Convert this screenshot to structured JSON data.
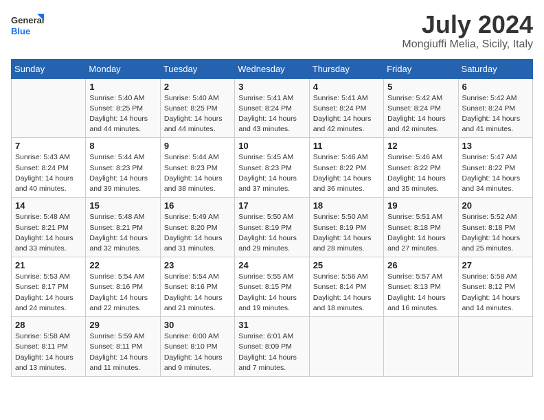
{
  "header": {
    "logo_line1": "General",
    "logo_line2": "Blue",
    "month": "July 2024",
    "location": "Mongiuffi Melia, Sicily, Italy"
  },
  "days_of_week": [
    "Sunday",
    "Monday",
    "Tuesday",
    "Wednesday",
    "Thursday",
    "Friday",
    "Saturday"
  ],
  "weeks": [
    [
      {
        "day": "",
        "sunrise": "",
        "sunset": "",
        "daylight": ""
      },
      {
        "day": "1",
        "sunrise": "Sunrise: 5:40 AM",
        "sunset": "Sunset: 8:25 PM",
        "daylight": "Daylight: 14 hours and 44 minutes."
      },
      {
        "day": "2",
        "sunrise": "Sunrise: 5:40 AM",
        "sunset": "Sunset: 8:25 PM",
        "daylight": "Daylight: 14 hours and 44 minutes."
      },
      {
        "day": "3",
        "sunrise": "Sunrise: 5:41 AM",
        "sunset": "Sunset: 8:24 PM",
        "daylight": "Daylight: 14 hours and 43 minutes."
      },
      {
        "day": "4",
        "sunrise": "Sunrise: 5:41 AM",
        "sunset": "Sunset: 8:24 PM",
        "daylight": "Daylight: 14 hours and 42 minutes."
      },
      {
        "day": "5",
        "sunrise": "Sunrise: 5:42 AM",
        "sunset": "Sunset: 8:24 PM",
        "daylight": "Daylight: 14 hours and 42 minutes."
      },
      {
        "day": "6",
        "sunrise": "Sunrise: 5:42 AM",
        "sunset": "Sunset: 8:24 PM",
        "daylight": "Daylight: 14 hours and 41 minutes."
      }
    ],
    [
      {
        "day": "7",
        "sunrise": "Sunrise: 5:43 AM",
        "sunset": "Sunset: 8:24 PM",
        "daylight": "Daylight: 14 hours and 40 minutes."
      },
      {
        "day": "8",
        "sunrise": "Sunrise: 5:44 AM",
        "sunset": "Sunset: 8:23 PM",
        "daylight": "Daylight: 14 hours and 39 minutes."
      },
      {
        "day": "9",
        "sunrise": "Sunrise: 5:44 AM",
        "sunset": "Sunset: 8:23 PM",
        "daylight": "Daylight: 14 hours and 38 minutes."
      },
      {
        "day": "10",
        "sunrise": "Sunrise: 5:45 AM",
        "sunset": "Sunset: 8:23 PM",
        "daylight": "Daylight: 14 hours and 37 minutes."
      },
      {
        "day": "11",
        "sunrise": "Sunrise: 5:46 AM",
        "sunset": "Sunset: 8:22 PM",
        "daylight": "Daylight: 14 hours and 36 minutes."
      },
      {
        "day": "12",
        "sunrise": "Sunrise: 5:46 AM",
        "sunset": "Sunset: 8:22 PM",
        "daylight": "Daylight: 14 hours and 35 minutes."
      },
      {
        "day": "13",
        "sunrise": "Sunrise: 5:47 AM",
        "sunset": "Sunset: 8:22 PM",
        "daylight": "Daylight: 14 hours and 34 minutes."
      }
    ],
    [
      {
        "day": "14",
        "sunrise": "Sunrise: 5:48 AM",
        "sunset": "Sunset: 8:21 PM",
        "daylight": "Daylight: 14 hours and 33 minutes."
      },
      {
        "day": "15",
        "sunrise": "Sunrise: 5:48 AM",
        "sunset": "Sunset: 8:21 PM",
        "daylight": "Daylight: 14 hours and 32 minutes."
      },
      {
        "day": "16",
        "sunrise": "Sunrise: 5:49 AM",
        "sunset": "Sunset: 8:20 PM",
        "daylight": "Daylight: 14 hours and 31 minutes."
      },
      {
        "day": "17",
        "sunrise": "Sunrise: 5:50 AM",
        "sunset": "Sunset: 8:19 PM",
        "daylight": "Daylight: 14 hours and 29 minutes."
      },
      {
        "day": "18",
        "sunrise": "Sunrise: 5:50 AM",
        "sunset": "Sunset: 8:19 PM",
        "daylight": "Daylight: 14 hours and 28 minutes."
      },
      {
        "day": "19",
        "sunrise": "Sunrise: 5:51 AM",
        "sunset": "Sunset: 8:18 PM",
        "daylight": "Daylight: 14 hours and 27 minutes."
      },
      {
        "day": "20",
        "sunrise": "Sunrise: 5:52 AM",
        "sunset": "Sunset: 8:18 PM",
        "daylight": "Daylight: 14 hours and 25 minutes."
      }
    ],
    [
      {
        "day": "21",
        "sunrise": "Sunrise: 5:53 AM",
        "sunset": "Sunset: 8:17 PM",
        "daylight": "Daylight: 14 hours and 24 minutes."
      },
      {
        "day": "22",
        "sunrise": "Sunrise: 5:54 AM",
        "sunset": "Sunset: 8:16 PM",
        "daylight": "Daylight: 14 hours and 22 minutes."
      },
      {
        "day": "23",
        "sunrise": "Sunrise: 5:54 AM",
        "sunset": "Sunset: 8:16 PM",
        "daylight": "Daylight: 14 hours and 21 minutes."
      },
      {
        "day": "24",
        "sunrise": "Sunrise: 5:55 AM",
        "sunset": "Sunset: 8:15 PM",
        "daylight": "Daylight: 14 hours and 19 minutes."
      },
      {
        "day": "25",
        "sunrise": "Sunrise: 5:56 AM",
        "sunset": "Sunset: 8:14 PM",
        "daylight": "Daylight: 14 hours and 18 minutes."
      },
      {
        "day": "26",
        "sunrise": "Sunrise: 5:57 AM",
        "sunset": "Sunset: 8:13 PM",
        "daylight": "Daylight: 14 hours and 16 minutes."
      },
      {
        "day": "27",
        "sunrise": "Sunrise: 5:58 AM",
        "sunset": "Sunset: 8:12 PM",
        "daylight": "Daylight: 14 hours and 14 minutes."
      }
    ],
    [
      {
        "day": "28",
        "sunrise": "Sunrise: 5:58 AM",
        "sunset": "Sunset: 8:11 PM",
        "daylight": "Daylight: 14 hours and 13 minutes."
      },
      {
        "day": "29",
        "sunrise": "Sunrise: 5:59 AM",
        "sunset": "Sunset: 8:11 PM",
        "daylight": "Daylight: 14 hours and 11 minutes."
      },
      {
        "day": "30",
        "sunrise": "Sunrise: 6:00 AM",
        "sunset": "Sunset: 8:10 PM",
        "daylight": "Daylight: 14 hours and 9 minutes."
      },
      {
        "day": "31",
        "sunrise": "Sunrise: 6:01 AM",
        "sunset": "Sunset: 8:09 PM",
        "daylight": "Daylight: 14 hours and 7 minutes."
      },
      {
        "day": "",
        "sunrise": "",
        "sunset": "",
        "daylight": ""
      },
      {
        "day": "",
        "sunrise": "",
        "sunset": "",
        "daylight": ""
      },
      {
        "day": "",
        "sunrise": "",
        "sunset": "",
        "daylight": ""
      }
    ]
  ]
}
